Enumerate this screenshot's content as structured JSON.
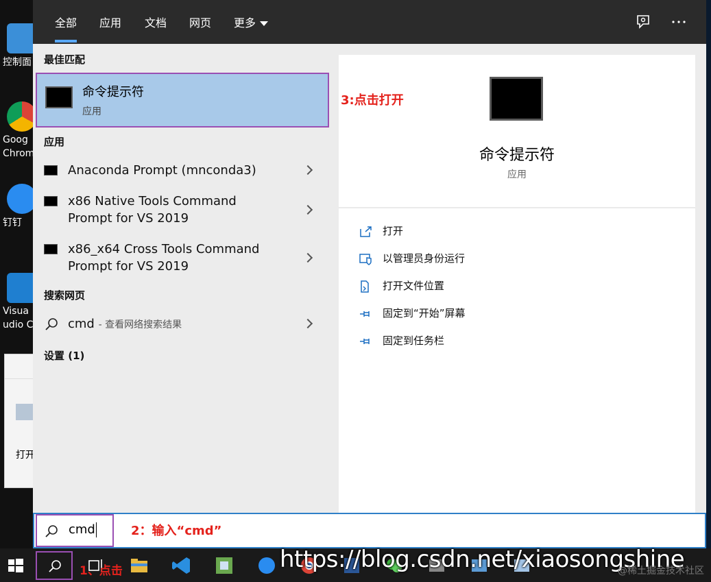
{
  "desktop": {
    "icons": [
      {
        "label": "控制面"
      },
      {
        "label": "Goog Chrom"
      },
      {
        "label": "钉钉"
      },
      {
        "label": "Visua udio C"
      }
    ],
    "window_label": "打开"
  },
  "menu": {
    "tabs": [
      {
        "label": "全部",
        "active": true
      },
      {
        "label": "应用"
      },
      {
        "label": "文档"
      },
      {
        "label": "网页"
      },
      {
        "label": "更多"
      }
    ],
    "sections": {
      "best_match": "最佳匹配",
      "apps": "应用",
      "web": "搜索网页",
      "settings": "设置 (1)"
    },
    "best_match": {
      "title": "命令提示符",
      "subtitle": "应用"
    },
    "apps": [
      {
        "line1": "Anaconda Prompt (mnconda3)",
        "line2": ""
      },
      {
        "line1": "x86 Native Tools Command",
        "line2": "Prompt for VS 2019"
      },
      {
        "line1": "x86_x64 Cross Tools Command",
        "line2": "Prompt for VS 2019"
      }
    ],
    "web": {
      "query": "cmd",
      "hint": "- 查看网络搜索结果"
    },
    "preview": {
      "title": "命令提示符",
      "subtitle": "应用"
    },
    "actions": [
      {
        "label": "打开",
        "icon": "open-icon"
      },
      {
        "label": "以管理员身份运行",
        "icon": "shield-icon"
      },
      {
        "label": "打开文件位置",
        "icon": "file-location-icon"
      },
      {
        "label": "固定到“开始”屏幕",
        "icon": "pin-icon"
      },
      {
        "label": "固定到任务栏",
        "icon": "pin-icon"
      }
    ]
  },
  "search": {
    "value": "cmd"
  },
  "annotations": {
    "step1": "1、点击",
    "step2": "2：输入“cmd”",
    "step3": "3:点击打开"
  },
  "watermark": {
    "url": "https://blog.csdn.net/xiaosongshine",
    "site": "@稀土掘金技术社区"
  },
  "colors": {
    "highlight": "#a8c9e9",
    "annotation_border": "#9a4fb3",
    "annotation_text": "#e4221c",
    "search_border": "#2f80c8",
    "menu_header": "#2b2b2b"
  }
}
